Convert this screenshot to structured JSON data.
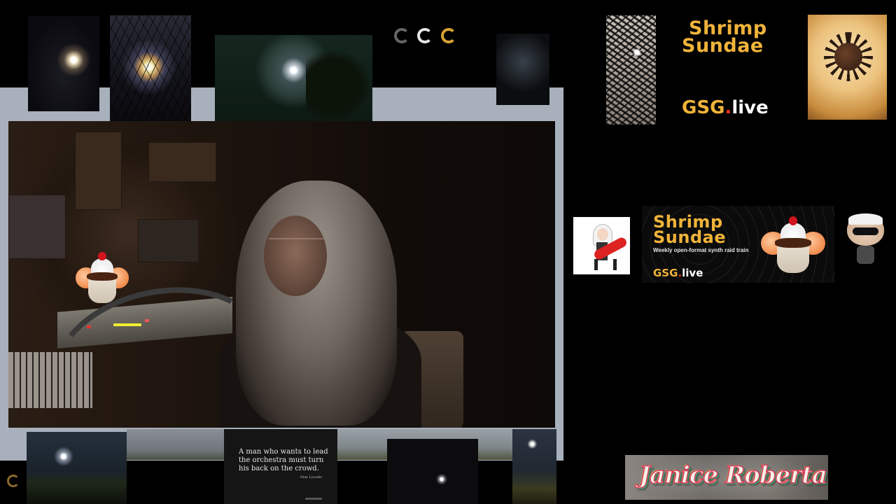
{
  "brand": {
    "title_line1": "Shrimp",
    "title_line2": "Sundae",
    "gsg": "GSG",
    "dot": ".",
    "live": "live",
    "tagline": "Weekly open-format synth raid train"
  },
  "quote": {
    "text": "A man who wants to lead the orchestra must turn his back on the crowd.",
    "author": "- Max Lucado"
  },
  "name_plate": {
    "name": "Janice Roberta"
  },
  "colors": {
    "brand_gold": "#f0b33a",
    "brand_red_dot": "#e8321c",
    "background": "#000000",
    "frame_slate": "#a7b0bb"
  },
  "icons": [
    "shrimp-logo-icon-gray",
    "shrimp-logo-icon-white",
    "shrimp-logo-icon-gold"
  ]
}
